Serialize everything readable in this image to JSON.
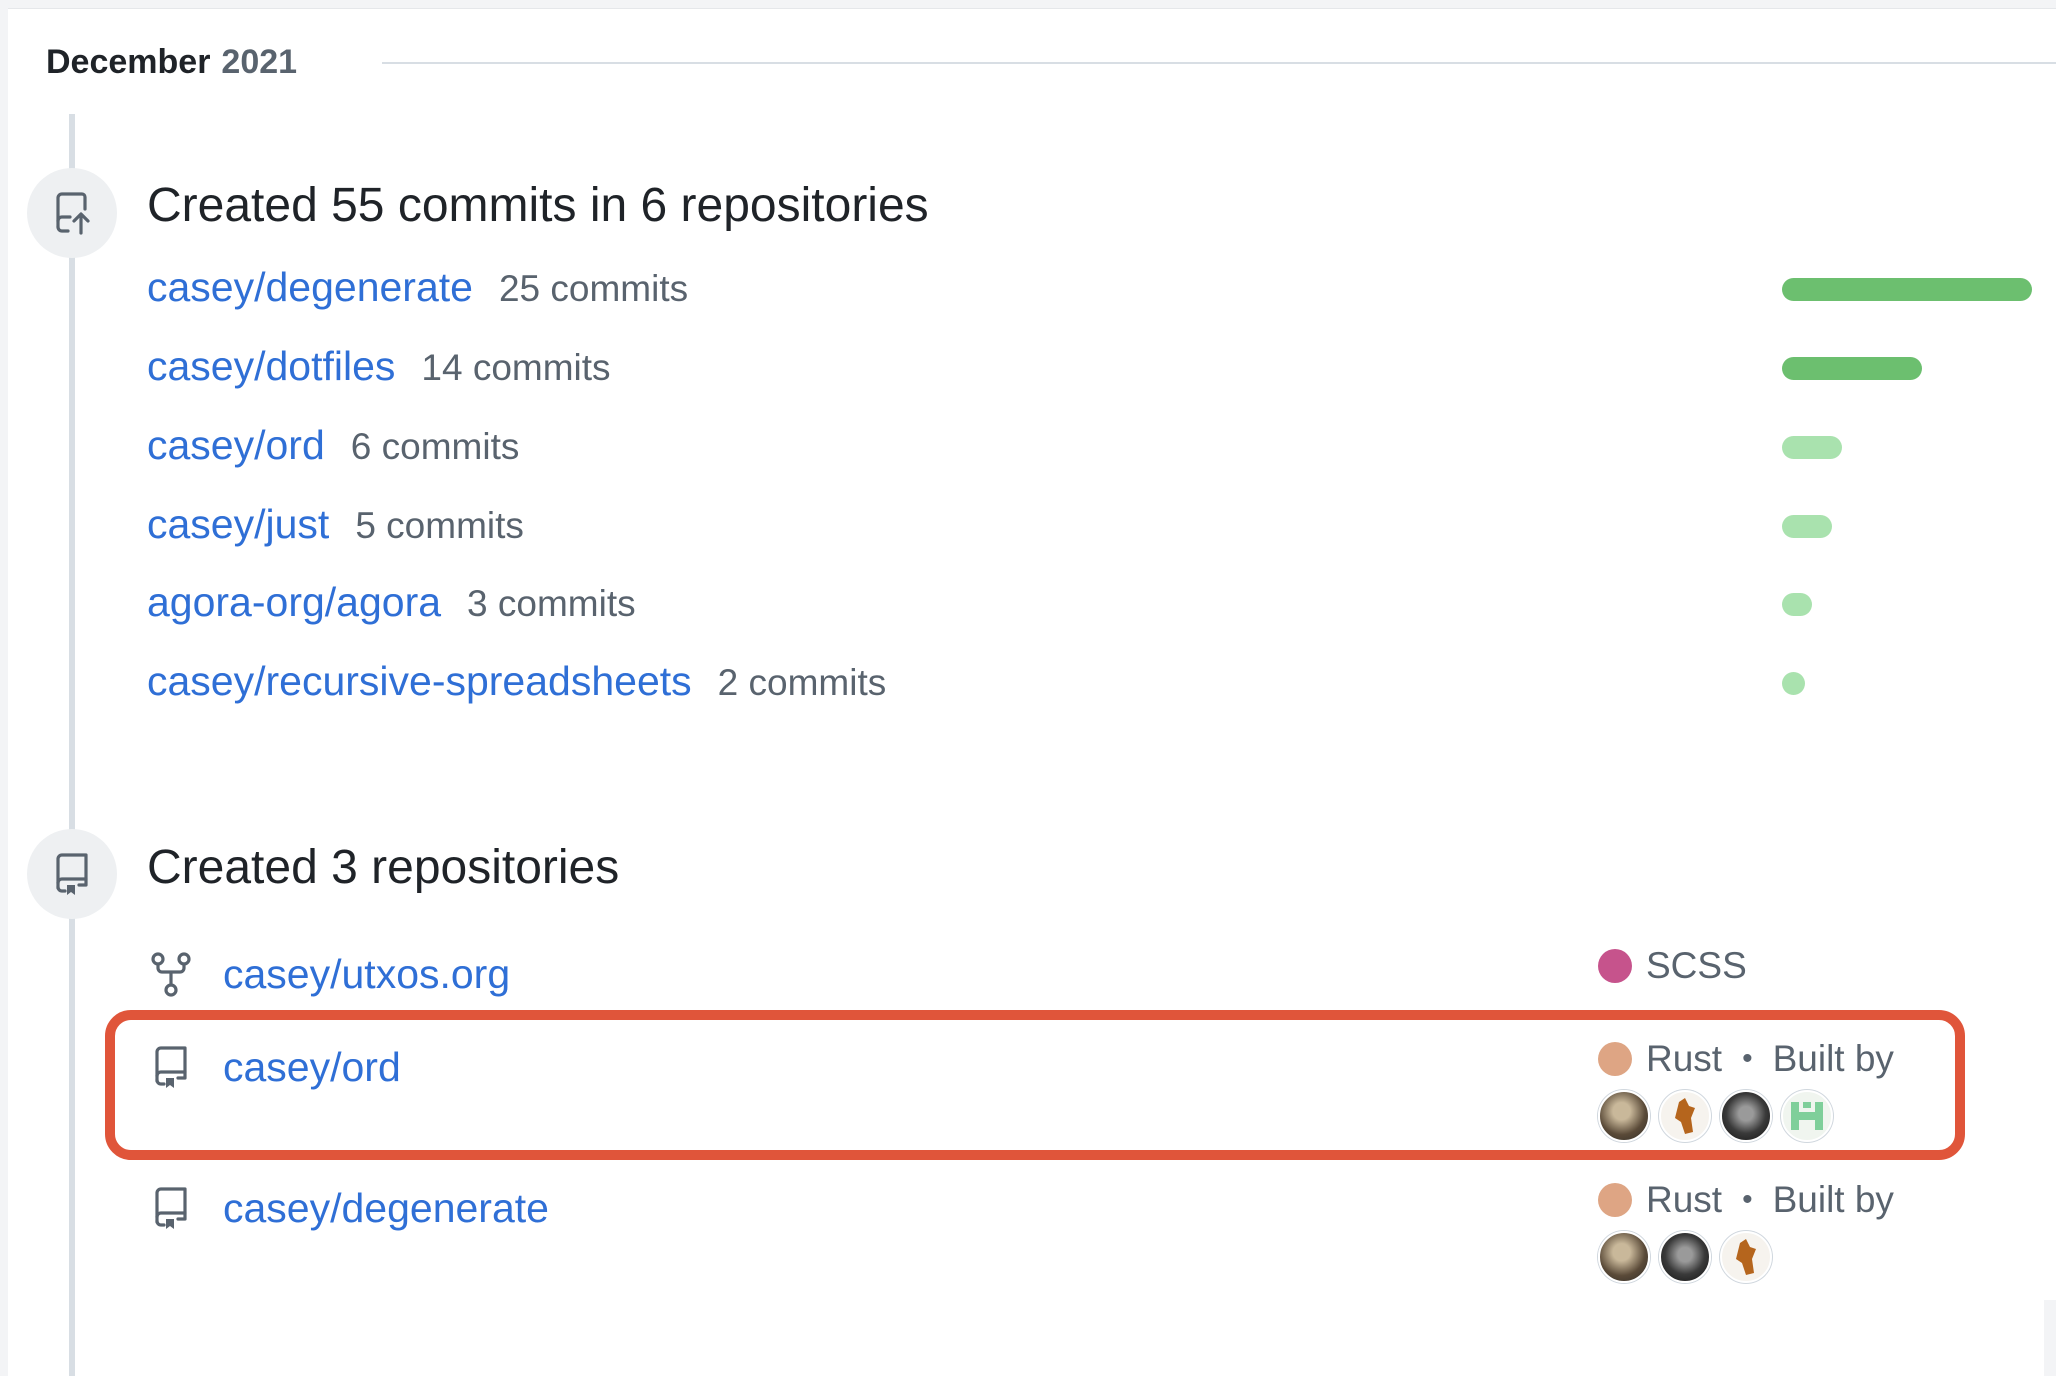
{
  "timeline": {
    "month": "December",
    "year": "2021"
  },
  "commits_section": {
    "title": "Created 55 commits in 6 repositories",
    "rows": [
      {
        "repo": "casey/degenerate",
        "count": "25 commits",
        "commits": 25
      },
      {
        "repo": "casey/dotfiles",
        "count": "14 commits",
        "commits": 14
      },
      {
        "repo": "casey/ord",
        "count": "6 commits",
        "commits": 6
      },
      {
        "repo": "casey/just",
        "count": "5 commits",
        "commits": 5
      },
      {
        "repo": "agora-org/agora",
        "count": "3 commits",
        "commits": 3
      },
      {
        "repo": "casey/recursive-spreadsheets",
        "count": "2 commits",
        "commits": 2
      }
    ]
  },
  "repos_section": {
    "title": "Created 3 repositories",
    "rows": [
      {
        "repo": "casey/utxos.org",
        "icon": "fork-icon",
        "language": "SCSS",
        "language_color": "#c6538c"
      },
      {
        "repo": "casey/ord",
        "icon": "repo-icon",
        "language": "Rust",
        "language_color": "#dea584",
        "built_by": "Built by",
        "avatars": 4
      },
      {
        "repo": "casey/degenerate",
        "icon": "repo-icon",
        "language": "Rust",
        "language_color": "#dea584",
        "built_by": "Built by",
        "avatars": 3
      }
    ]
  },
  "colors": {
    "link": "#2f6fd6",
    "bar_dark": "#6cbf6f",
    "bar_light": "#a9e2ae",
    "highlight": "#e0553a"
  }
}
